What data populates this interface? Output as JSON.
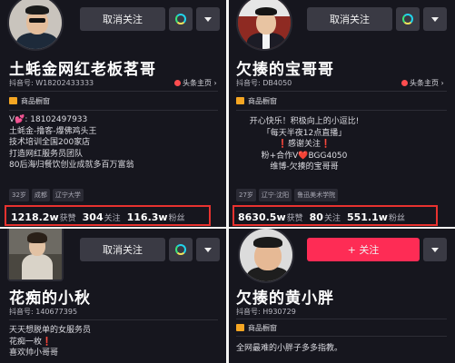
{
  "accent": {
    "follow_red": "#fe2c55",
    "highlight": "#e8322f",
    "window_icon": "#f5a623"
  },
  "profiles": [
    {
      "name": "土蚝金网红老板茗哥",
      "id_line": "抖音号: W18202433333",
      "follow_label": "取消关注",
      "headline_label": "头条主页",
      "window_label": "商品橱窗",
      "bio": "V💕: 18102497933\n土蚝金-撸客-爆佛鸡头王\n技术培训全国200家店\n打造网红服务员团队\n80后海归餐饮创业成就多百万富翁",
      "tags": [
        "32岁",
        "成都",
        "辽宁大学"
      ],
      "stats": [
        {
          "num": "1218.2w",
          "label": "获赞"
        },
        {
          "num": "304",
          "label": "关注"
        },
        {
          "num": "116.3w",
          "label": "粉丝"
        }
      ]
    },
    {
      "name": "欠揍的宝哥哥",
      "id_line": "抖音号: DB4050",
      "follow_label": "取消关注",
      "headline_label": "头条主页",
      "window_label": "商品橱窗",
      "bio": "开心快乐！积极向上的小逗比!\n「每天半夜12点直播」\n❗感谢关注❗\n粉+合作V❤️BGG4050\n维博-欠揍的宝哥哥",
      "tags": [
        "27岁",
        "辽宁·沈阳",
        "鲁迅美术学院"
      ],
      "stats": [
        {
          "num": "8630.5w",
          "label": "获赞"
        },
        {
          "num": "80",
          "label": "关注"
        },
        {
          "num": "551.1w",
          "label": "粉丝"
        }
      ]
    },
    {
      "name": "花痴的小秋",
      "id_line": "抖音号: 140677395",
      "follow_label": "取消关注",
      "bio": "天天想脱单的女服务员\n花痴一枚❗\n喜欢帅小哥哥"
    },
    {
      "name": "欠揍的黄小胖",
      "id_line": "抖音号: H930729",
      "follow_label": "+ 关注",
      "window_label": "商品橱窗",
      "bio": "全网最难的小胖子多多指教。"
    }
  ]
}
